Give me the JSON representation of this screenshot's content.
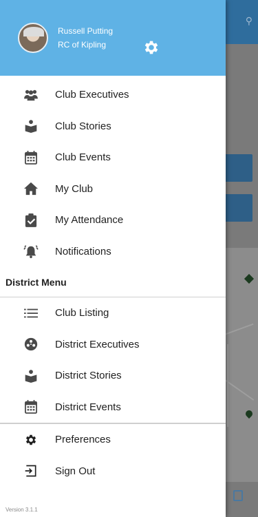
{
  "user": {
    "name": "Russell Putting",
    "club": "RC of Kipling"
  },
  "club_menu": [
    {
      "label": "Club Executives",
      "icon": "group-icon"
    },
    {
      "label": "Club Stories",
      "icon": "book-reader-icon"
    },
    {
      "label": "Club Events",
      "icon": "calendar-icon"
    },
    {
      "label": "My Club",
      "icon": "home-icon"
    },
    {
      "label": "My Attendance",
      "icon": "clipboard-check-icon"
    },
    {
      "label": "Notifications",
      "icon": "alarm-bell-icon"
    }
  ],
  "district": {
    "title": "District Menu",
    "items": [
      {
        "label": "Club Listing",
        "icon": "list-icon"
      },
      {
        "label": "District Executives",
        "icon": "rotary-wheel-icon"
      },
      {
        "label": "District Stories",
        "icon": "book-reader-icon"
      },
      {
        "label": "District Events",
        "icon": "calendar-icon"
      }
    ]
  },
  "footer_menu": [
    {
      "label": "Preferences",
      "icon": "gear-icon"
    },
    {
      "label": "Sign Out",
      "icon": "sign-out-icon"
    }
  ],
  "version": "Version 3.1.1",
  "colors": {
    "header": "#5fb2e5",
    "icon": "#4a4a4a",
    "text": "#1f1f1f"
  }
}
